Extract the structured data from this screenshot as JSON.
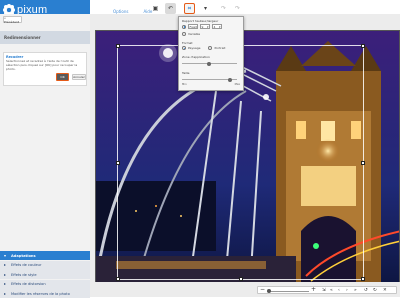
{
  "app": {
    "brand": "pixum",
    "top_links": [
      "Options",
      "Aide"
    ]
  },
  "toolbar": {
    "icons": [
      "save-icon",
      "undo-icon",
      "crop-icon",
      "view-icon",
      "redo-icon",
      "forward-icon"
    ]
  },
  "left_panel": {
    "back_label": "« Précédent",
    "title": "Redimensionner",
    "crop": {
      "heading": "Recadrer",
      "description": "Sélectionnez et recadrez à l’aide de l’outil de sélection puis cliquez sur [OK] pour recouper la photo.",
      "ok_label": "OK",
      "cancel_label": "Annuler"
    },
    "nav": [
      {
        "label": "Adaptations",
        "active": true
      },
      {
        "label": "Effets de couleur",
        "active": false
      },
      {
        "label": "Effets de style",
        "active": false
      },
      {
        "label": "Effets de distorsion",
        "active": false
      },
      {
        "label": "Modifier les réserves de la photo",
        "active": false
      }
    ]
  },
  "popup": {
    "ratio_section": "Rapport hauteur/largeur",
    "ratio_select_a": "Fixe",
    "ratio_select_b": "9",
    "ratio_select_c": "4",
    "ratio_option_free": "Variable",
    "format_section": "Format",
    "format_landscape": "Paysage",
    "format_portrait": "Portrait",
    "zone_section": "Zone d'application",
    "size_section": "Taille",
    "scale_min": "Min",
    "scale_max": "Max"
  },
  "colors": {
    "brand_blue": "#2a7fd0",
    "highlight_orange": "#e55b18",
    "panel_bg": "#f2f2f2"
  }
}
